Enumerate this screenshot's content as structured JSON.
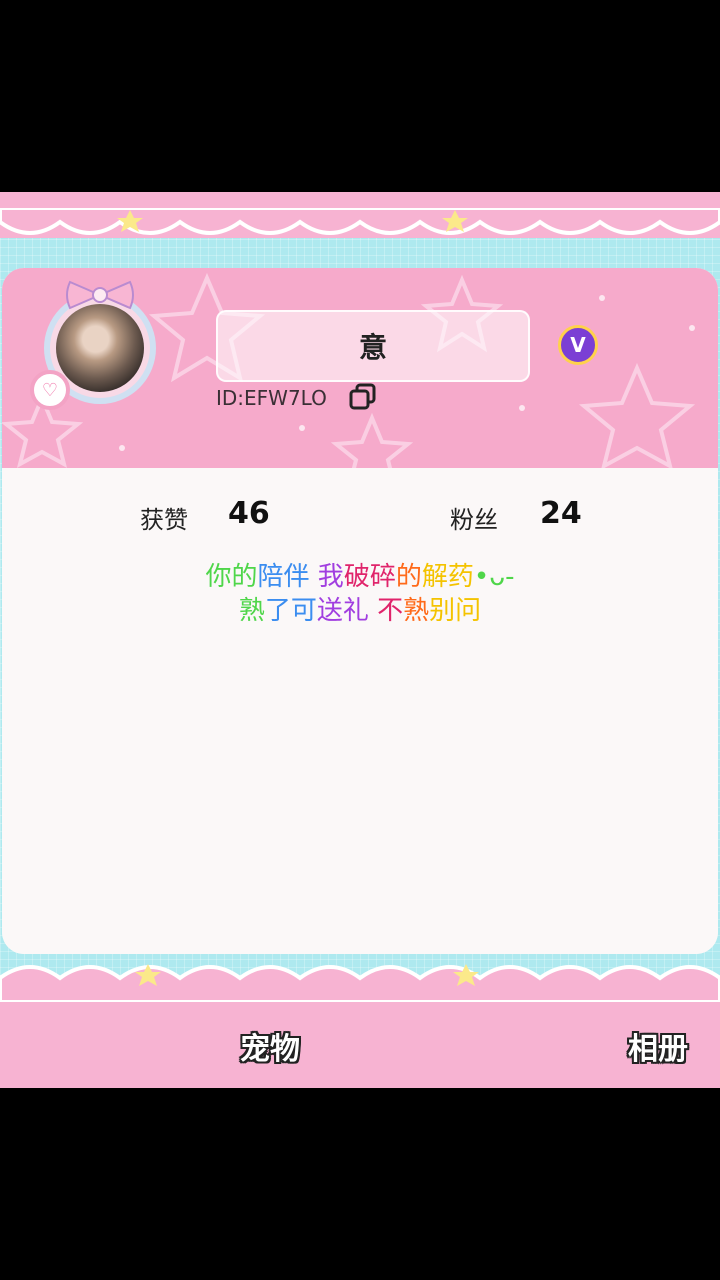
{
  "profile": {
    "name": "意",
    "user_id": "ID:EFW7LO",
    "vip_badge": "V",
    "heart_badge": "♡"
  },
  "stats": {
    "likes_label": "获赞",
    "likes_value": "46",
    "fans_label": "粉丝",
    "fans_value": "24"
  },
  "bio": {
    "line1": [
      "你的",
      "陪伴",
      " 我",
      "破碎",
      "的",
      "解药",
      "•ᴗ-"
    ],
    "line2": [
      "熟",
      "了可",
      "送礼",
      " 不",
      "熟",
      "别问"
    ],
    "colors": [
      "#4fd64a",
      "#3b8df0",
      "#a13ee0",
      "#e0246b",
      "#ff6a1a",
      "#f4c300"
    ]
  },
  "tabs": {
    "pet": "宠物",
    "album": "相册"
  },
  "colors": {
    "pink": "#f7b3d2",
    "cyan": "#aee9ef",
    "vip_purple": "#7b3fd4"
  }
}
